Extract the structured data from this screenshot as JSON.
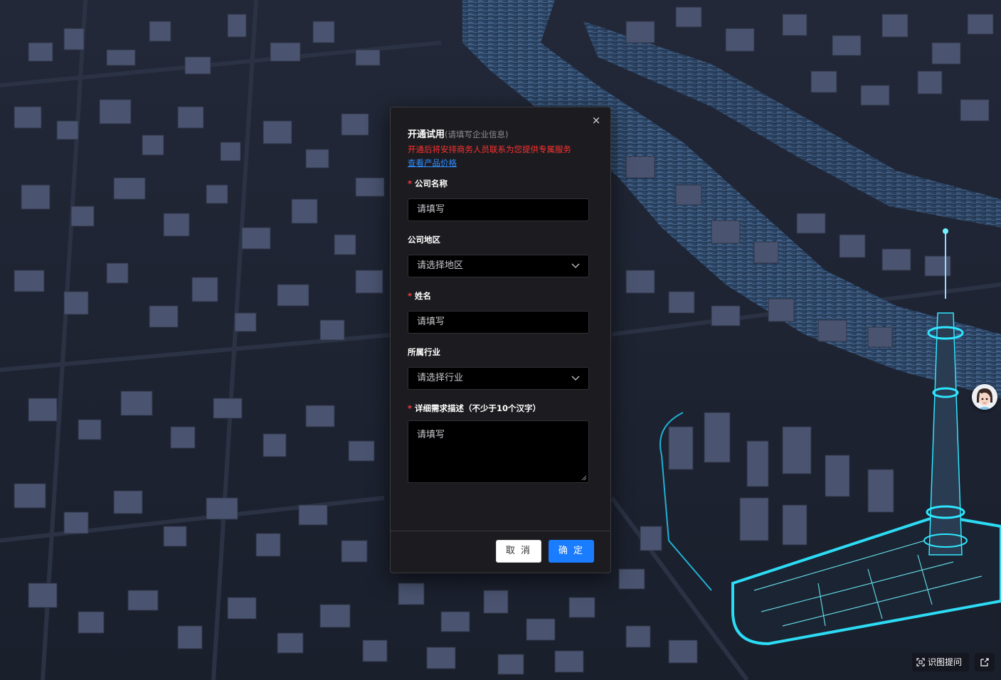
{
  "dialog": {
    "title": "开通试用",
    "subtitle": "(请填写企业信息)",
    "notice": "开通后将安排商务人员联系为您提供专属服务",
    "price_link": "查看产品价格",
    "close_glyph": "×",
    "required_mark": "*",
    "fields": {
      "company": {
        "label": "公司名称",
        "placeholder": "请填写",
        "required": true
      },
      "region": {
        "label": "公司地区",
        "placeholder": "请选择地区",
        "required": false
      },
      "name": {
        "label": "姓名",
        "placeholder": "请填写",
        "required": true
      },
      "industry": {
        "label": "所属行业",
        "placeholder": "请选择行业",
        "required": false
      },
      "description": {
        "label": "详细需求描述（不少于10个汉字）",
        "placeholder": "请填写",
        "required": true
      }
    },
    "buttons": {
      "cancel": "取 消",
      "confirm": "确 定"
    }
  },
  "toolbar": {
    "scan_label": "识图提问"
  },
  "icons": {
    "close": "close-icon",
    "chevron": "chevron-down-icon",
    "scan": "scan-icon",
    "share": "share-icon",
    "avatar": "avatar-icon"
  },
  "colors": {
    "accent": "#1a7cff",
    "notice": "#ff3030",
    "link": "#2f8cff",
    "required": "#ff3b3b",
    "dialog_bg": "#1c1c20",
    "field_bg": "#000000",
    "glow": "#22d4ff"
  }
}
